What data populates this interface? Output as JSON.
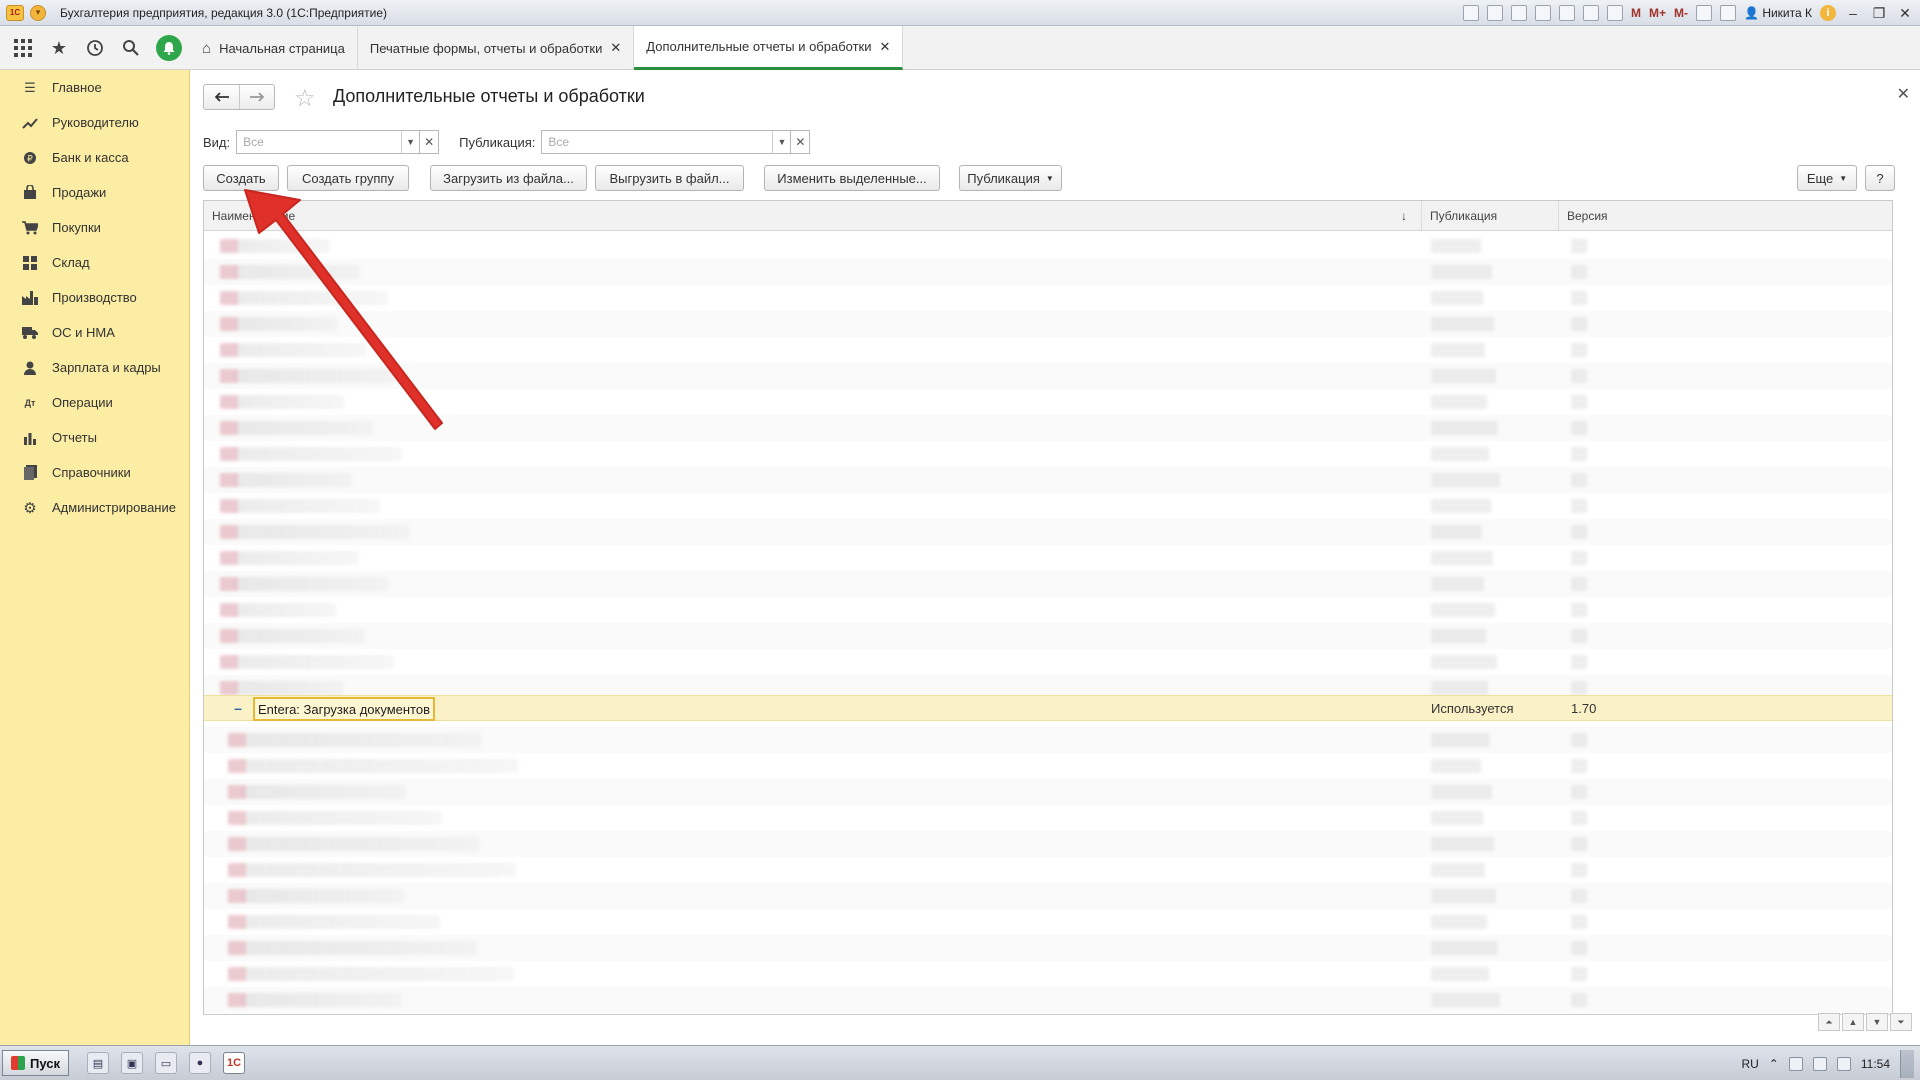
{
  "window": {
    "title": "Бухгалтерия предприятия, редакция 3.0  (1С:Предприятие)",
    "logo_text": "1С",
    "user": "Никита К",
    "m_buttons": [
      "M",
      "M+",
      "M-"
    ]
  },
  "toolbar": {
    "icons": [
      "grid-icon",
      "star-icon",
      "history-icon",
      "search-icon",
      "bell-icon"
    ]
  },
  "tabs": [
    {
      "label": "Начальная страница",
      "icon": "home-icon"
    },
    {
      "label": "Печатные формы, отчеты и обработки"
    },
    {
      "label": "Дополнительные отчеты и обработки",
      "active": true
    }
  ],
  "sidebar": {
    "items": [
      {
        "label": "Главное",
        "icon": "menu-icon"
      },
      {
        "label": "Руководителю",
        "icon": "trend-icon"
      },
      {
        "label": "Банк и касса",
        "icon": "coin-icon"
      },
      {
        "label": "Продажи",
        "icon": "bag-icon"
      },
      {
        "label": "Покупки",
        "icon": "cart-icon"
      },
      {
        "label": "Склад",
        "icon": "warehouse-icon"
      },
      {
        "label": "Производство",
        "icon": "factory-icon"
      },
      {
        "label": "ОС и НМА",
        "icon": "truck-icon"
      },
      {
        "label": "Зарплата и кадры",
        "icon": "person-icon"
      },
      {
        "label": "Операции",
        "icon": "operations-icon"
      },
      {
        "label": "Отчеты",
        "icon": "bar-chart-icon"
      },
      {
        "label": "Справочники",
        "icon": "book-icon"
      },
      {
        "label": "Администрирование",
        "icon": "gear-icon"
      }
    ]
  },
  "page": {
    "title": "Дополнительные отчеты и обработки"
  },
  "filters": {
    "kind_label": "Вид:",
    "kind_value": "Все",
    "publication_label": "Публикация:",
    "publication_value": "Все"
  },
  "commands": {
    "create": "Создать",
    "create_group": "Создать группу",
    "load_from_file": "Загрузить из файла...",
    "save_to_file": "Выгрузить в файл...",
    "change_selected": "Изменить выделенные...",
    "publication": "Публикация",
    "more": "Еще",
    "help": "?"
  },
  "table": {
    "columns": [
      "Наименование",
      "Публикация",
      "Версия"
    ],
    "sort_indicator": "↓",
    "selected_row": {
      "name": "Entera: Загрузка документов",
      "publication": "Используется",
      "version": "1.70"
    }
  },
  "taskbar": {
    "start_label": "Пуск",
    "language": "RU",
    "time": "11:54"
  },
  "colors": {
    "sidebar_bg": "#fbeda3",
    "accent_green": "#2d8f3e",
    "selection_bg": "#fbf1c6",
    "arrow_red": "#e0302a"
  }
}
